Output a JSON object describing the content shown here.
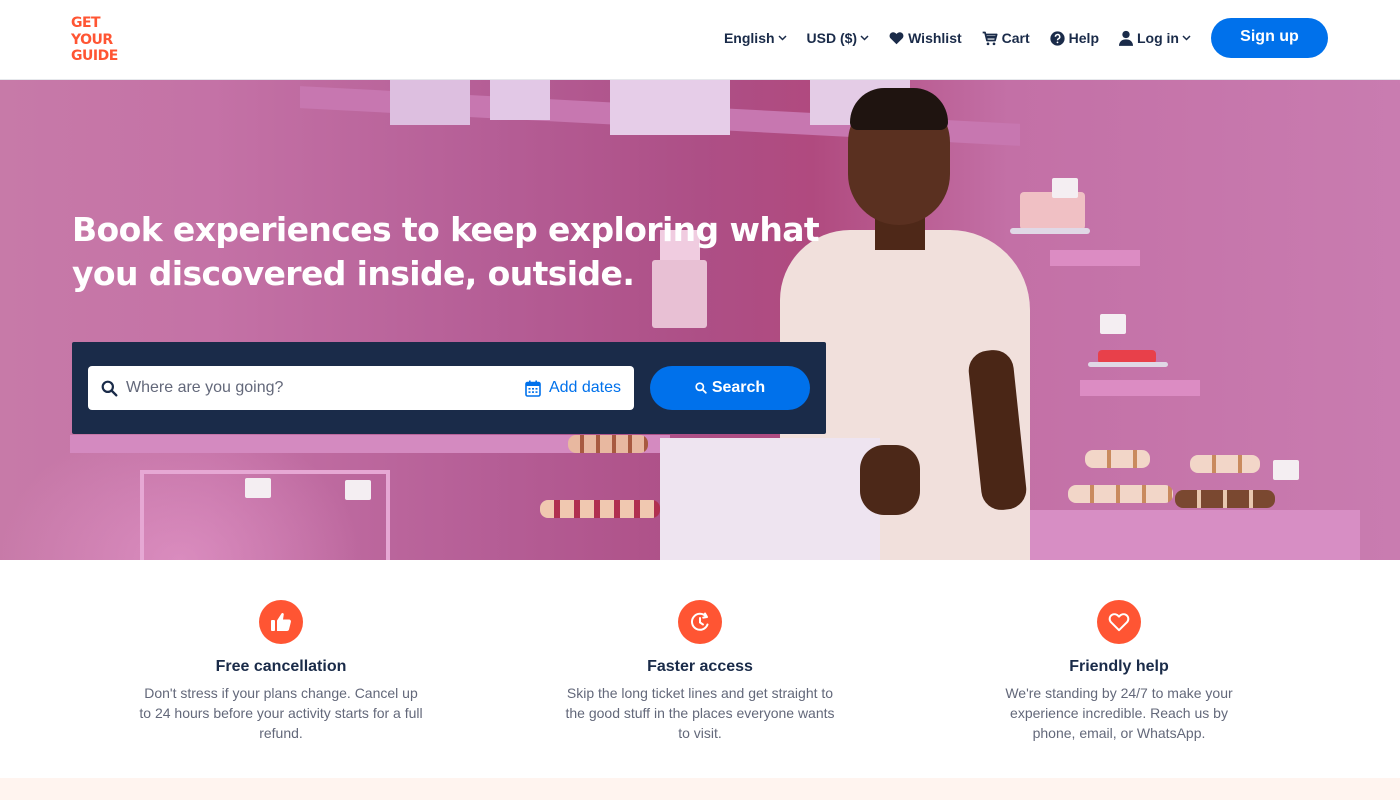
{
  "header": {
    "logo": [
      "GET",
      "YOUR",
      "GUIDE"
    ],
    "nav": {
      "language": "English",
      "currency": "USD ($)",
      "wishlist": "Wishlist",
      "cart": "Cart",
      "help": "Help",
      "login": "Log in"
    },
    "signup_label": "Sign up"
  },
  "hero": {
    "title": "Book experiences to keep exploring what you discovered inside, outside.",
    "search": {
      "placeholder": "Where are you going?",
      "value": "",
      "dates_label": "Add dates",
      "button_label": "Search"
    }
  },
  "features": [
    {
      "icon": "thumbs-up-icon",
      "title": "Free cancellation",
      "text": "Don't stress if your plans change. Cancel up to 24 hours before your activity starts for a full refund."
    },
    {
      "icon": "clock-refresh-icon",
      "title": "Faster access",
      "text": "Skip the long ticket lines and get straight to the good stuff in the places everyone wants to visit."
    },
    {
      "icon": "heart-icon",
      "title": "Friendly help",
      "text": "We're standing by 24/7 to make your experience incredible. Reach us by phone, email, or WhatsApp."
    }
  ],
  "colors": {
    "brand_orange": "#ff5533",
    "primary_blue": "#0071eb",
    "navy": "#1a2b49",
    "muted_text": "#63687a",
    "strip": "#fff4ef"
  }
}
